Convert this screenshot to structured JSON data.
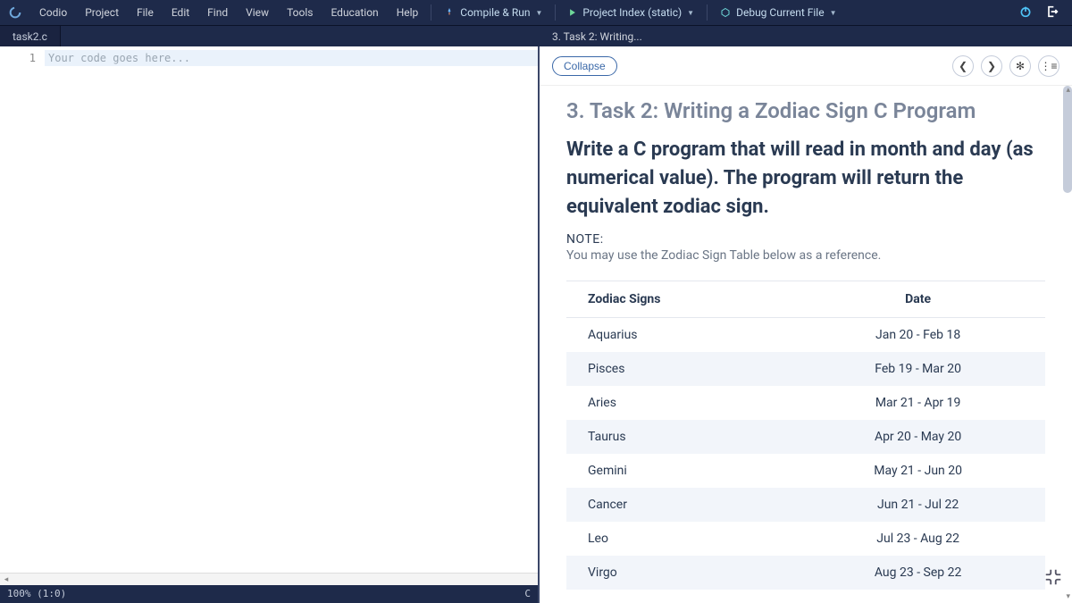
{
  "menubar": {
    "app": "Codio",
    "items": [
      "Codio",
      "Project",
      "File",
      "Edit",
      "Find",
      "View",
      "Tools",
      "Education",
      "Help"
    ],
    "actions": {
      "compile": "Compile & Run",
      "project_index": "Project Index (static)",
      "debug": "Debug Current File"
    }
  },
  "tabs": {
    "editor": "task2.c",
    "guide": "3. Task 2: Writing..."
  },
  "editor": {
    "line_number": "1",
    "placeholder": "Your code goes here...",
    "status_left": "100% (1:0)",
    "status_right": "C"
  },
  "guide": {
    "collapse": "Collapse",
    "title": "3. Task 2: Writing a Zodiac Sign C Program",
    "instruction": "Write a C program that will read in month and day (as numerical value). The program will return the equivalent zodiac sign.",
    "note_label": "NOTE:",
    "note_text": "You may use the Zodiac Sign Table below as a reference.",
    "table": {
      "headers": [
        "Zodiac Signs",
        "Date"
      ],
      "rows": [
        {
          "sign": "Aquarius",
          "date": "Jan 20 - Feb 18"
        },
        {
          "sign": "Pisces",
          "date": "Feb 19 - Mar 20"
        },
        {
          "sign": "Aries",
          "date": "Mar 21 - Apr 19"
        },
        {
          "sign": "Taurus",
          "date": "Apr 20 - May 20"
        },
        {
          "sign": "Gemini",
          "date": "May 21 - Jun 20"
        },
        {
          "sign": "Cancer",
          "date": "Jun 21 - Jul 22"
        },
        {
          "sign": "Leo",
          "date": "Jul 23 - Aug 22"
        },
        {
          "sign": "Virgo",
          "date": "Aug 23 - Sep 22"
        }
      ]
    }
  }
}
